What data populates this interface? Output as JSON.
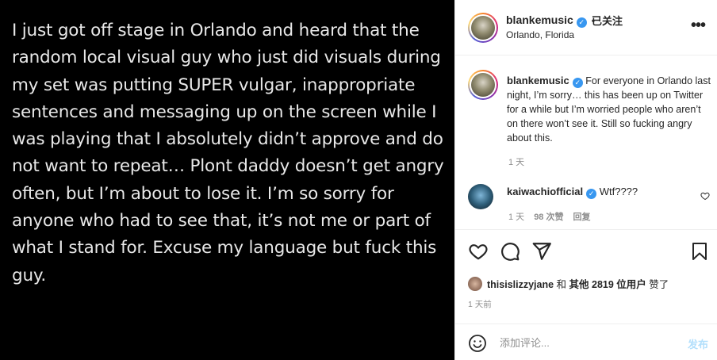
{
  "post": {
    "text": "I just got off stage in Orlando and heard that the random local visual guy who just did visuals during my set was putting SUPER vulgar, inappropriate sentences and messaging up on the screen while I was playing that I absolutely didn’t approve and do not want to repeat… Plont daddy doesn’t get angry often, but I’m about to lose it. I’m so sorry for anyone who had to see that, it’s not me or part of what I stand for. Excuse my language but fuck this guy."
  },
  "header": {
    "username": "blankemusic",
    "verified_icon": "verified-badge-icon",
    "separator": "•",
    "follow_label": "已关注",
    "location": "Orlando, Florida",
    "more_icon": "more-options-icon",
    "more_label": "•••"
  },
  "caption": {
    "username": "blankemusic",
    "text": "For everyone in Orlando last night, I’m sorry… this has been up on Twitter for a while but I’m worried people who aren’t on there won’t see it. Still so fucking angry about this.",
    "time": "1 天"
  },
  "comments": [
    {
      "username": "kaiwachiofficial",
      "text": "Wtf????",
      "time": "1 天",
      "likes": "98 次赞",
      "reply_label": "回复"
    }
  ],
  "actions": {
    "like_icon": "heart-icon",
    "comment_icon": "comment-icon",
    "share_icon": "send-icon",
    "save_icon": "bookmark-icon"
  },
  "likes": {
    "user": "thisislizzyjane",
    "connector": "和",
    "others": "其他 2819 位用户",
    "suffix": "赞了"
  },
  "post_time": "1 天前",
  "comment_box": {
    "emoji_icon": "emoji-icon",
    "placeholder": "添加评论...",
    "publish_label": "发布"
  },
  "colors": {
    "accent": "#3897f0",
    "publish_disabled": "#b2dffc",
    "muted": "#8e8e8e"
  }
}
